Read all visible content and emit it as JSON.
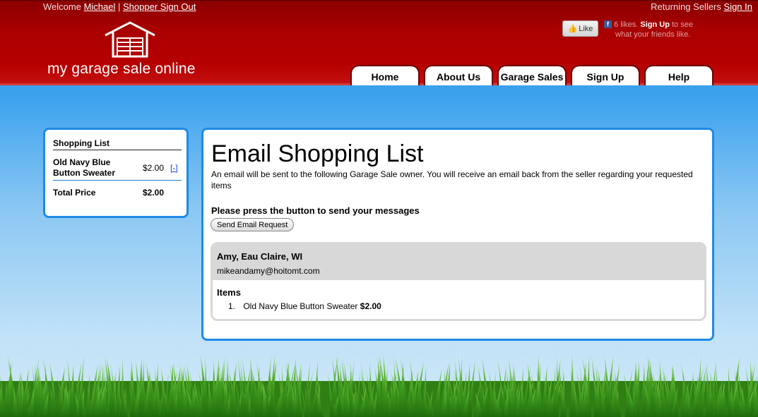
{
  "header": {
    "welcome_prefix": "Welcome",
    "user_name": "Michael",
    "separator": "|",
    "signout_label": "Shopper Sign Out",
    "returning_label": "Returning Sellers",
    "signin_label": "Sign In",
    "logo_text": "my garage sale online",
    "facebook": {
      "like_label": "Like",
      "likes_text": "6 likes.",
      "signup_label": "Sign Up",
      "suffix_text": "to see",
      "line2": "what your friends like."
    },
    "nav": [
      {
        "label": "Home"
      },
      {
        "label": "About Us"
      },
      {
        "label": "Garage Sales"
      },
      {
        "label": "Sign Up"
      },
      {
        "label": "Help"
      }
    ]
  },
  "sidebar": {
    "title": "Shopping List",
    "item_name": "Old Navy Blue Button Sweater",
    "item_price": "$2.00",
    "remove_label": "[-]",
    "total_label": "Total Price",
    "total_value": "$2.00"
  },
  "main": {
    "title": "Email Shopping List",
    "description": "An email will be sent to the following Garage Sale owner. You will receive an email back from the seller regarding your requested items",
    "instruction": "Please press the button to send your messages",
    "send_button": "Send Email Request",
    "seller": {
      "name": "Amy, Eau Claire, WI",
      "email": "mikeandamy@hoitomt.com",
      "items_title": "Items",
      "items": [
        {
          "number": "1.",
          "name": "Old Navy Blue Button Sweater",
          "price": "$2.00"
        }
      ]
    }
  },
  "colors": {
    "header_red": "#a80000",
    "panel_border_blue": "#1f8ae6",
    "sky_blue": "#3ea3ee",
    "link_blue": "#1a3fd8"
  }
}
